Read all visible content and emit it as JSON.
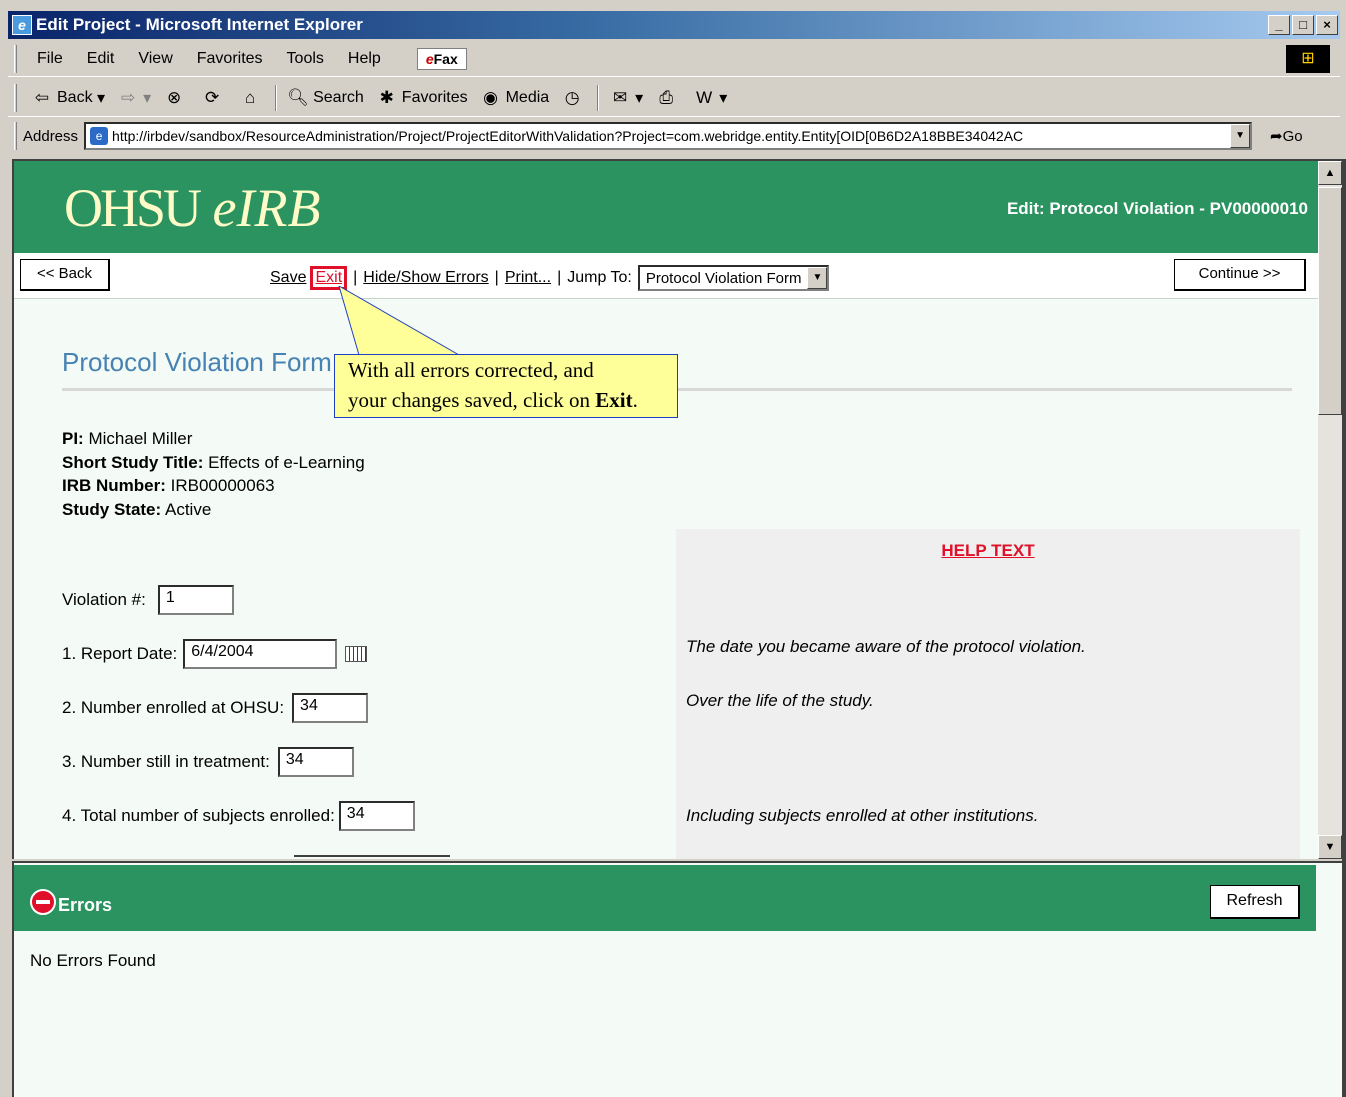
{
  "window": {
    "title": "Edit Project - Microsoft Internet Explorer",
    "min_glyph": "_",
    "max_glyph": "□",
    "close_glyph": "×"
  },
  "menu": {
    "items": [
      "File",
      "Edit",
      "View",
      "Favorites",
      "Tools",
      "Help"
    ],
    "efax_e": "e",
    "efax_rest": "Fax"
  },
  "toolbar": {
    "back": "Back",
    "search": "Search",
    "favorites": "Favorites",
    "media": "Media"
  },
  "address": {
    "label": "Address",
    "url": "http://irbdev/sandbox/ResourceAdministration/Project/ProjectEditorWithValidation?Project=com.webridge.entity.Entity[OID[0B6D2A18BBE34042AC",
    "go": "Go"
  },
  "banner": {
    "logo_ohsu": "OHSU",
    "logo_eirb": "eIRB",
    "title": "Edit: Protocol Violation - PV00000010"
  },
  "nav": {
    "back": "<< Back",
    "save": "Save",
    "exit": "Exit",
    "hide_show": "Hide/Show Errors",
    "print": "Print...",
    "jump_label": "Jump To:",
    "jump_value": "Protocol Violation Form",
    "continue": "Continue >>"
  },
  "form": {
    "title": "Protocol Violation Form",
    "pi_label": "PI:",
    "pi_value": "Michael  Miller",
    "short_title_label": "Short Study Title:",
    "short_title_value": "Effects of e-Learning",
    "irb_label": "IRB Number:",
    "irb_value": "IRB00000063",
    "state_label": "Study State:",
    "state_value": "Active",
    "fields": [
      {
        "label": "Violation #:",
        "value": "1"
      },
      {
        "label": "1. Report Date:",
        "value": "6/4/2004"
      },
      {
        "label": "2.  Number enrolled at OHSU:",
        "value": "34"
      },
      {
        "label": "3.  Number still in treatment:",
        "value": "34"
      },
      {
        "label": "4.  Total number of subjects enrolled:",
        "value": "34"
      }
    ]
  },
  "callout": {
    "line1": "With all errors corrected, and",
    "line2_pre": "your changes saved, click on ",
    "line2_bold": "Exit",
    "line2_post": "."
  },
  "help": {
    "title": "HELP TEXT",
    "texts": [
      "The date you became aware of the protocol violation.",
      "Over the life of the study.",
      "Including subjects enrolled at other institutions."
    ]
  },
  "errors": {
    "title": "Errors",
    "refresh": "Refresh",
    "message": "No Errors Found"
  },
  "colors": {
    "brand_green": "#2a9360",
    "logo_cream": "#fffbc8",
    "accent_red": "#e0102a",
    "title_blue": "#4682b4"
  }
}
